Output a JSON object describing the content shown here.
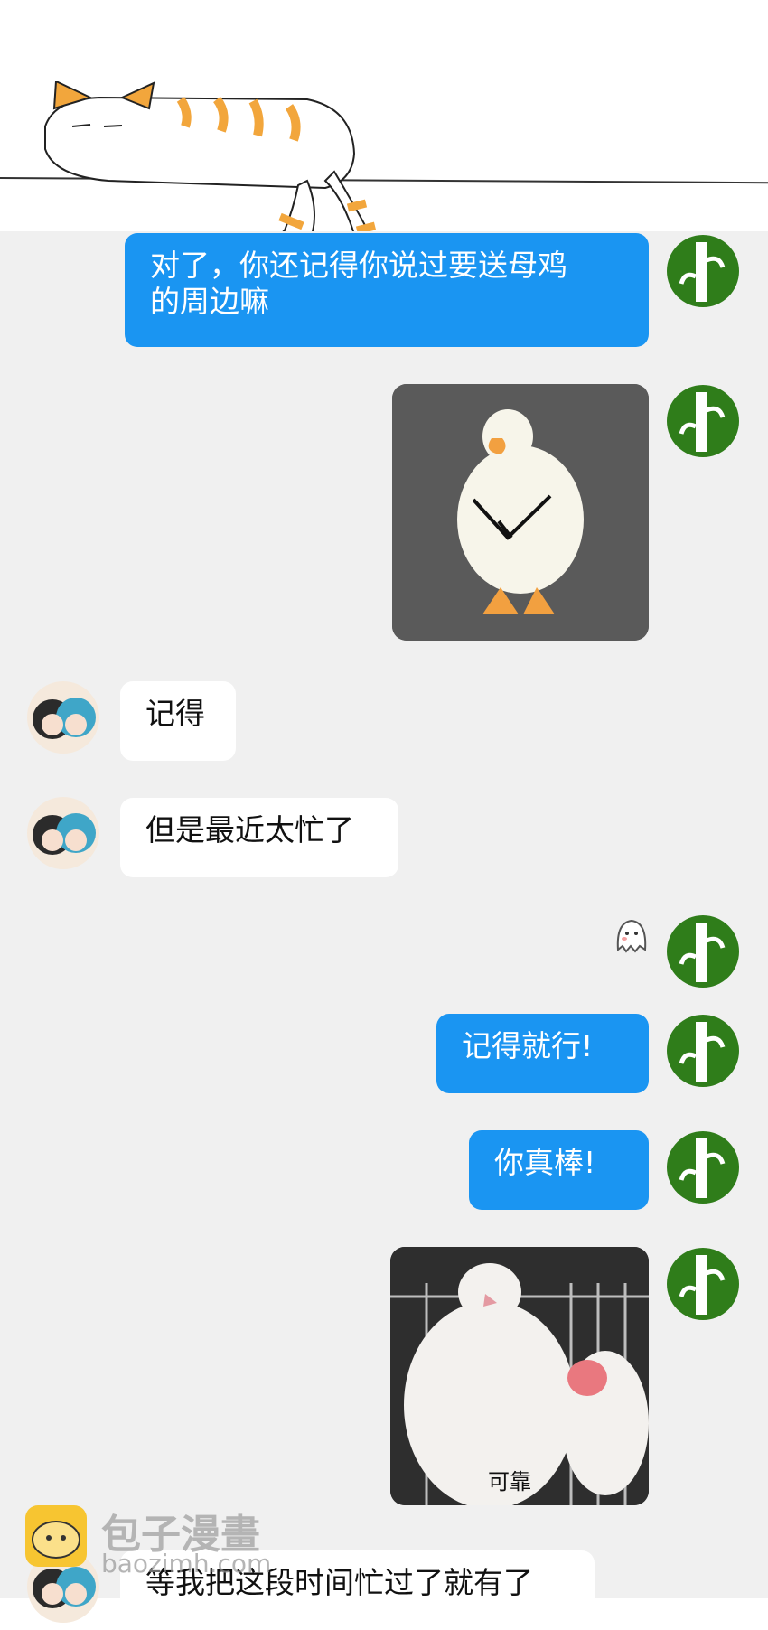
{
  "messages": [
    {
      "side": "me",
      "type": "text",
      "text": "对了，你还记得你说过要送母鸡\n的周边嘛"
    },
    {
      "side": "me",
      "type": "image",
      "image_name": "duck-photo"
    },
    {
      "side": "them",
      "type": "text",
      "text": "记得"
    },
    {
      "side": "them",
      "type": "text",
      "text": "但是最近太忙了"
    },
    {
      "side": "me",
      "type": "sticker",
      "image_name": "ghost-sticker"
    },
    {
      "side": "me",
      "type": "text",
      "text": "记得就行!"
    },
    {
      "side": "me",
      "type": "text",
      "text": "你真棒!"
    },
    {
      "side": "me",
      "type": "image",
      "image_name": "birds-photo",
      "caption": "可靠"
    },
    {
      "side": "them",
      "type": "text",
      "text": "等我把这段时间忙过了就有了"
    }
  ],
  "watermark": {
    "title": "包子漫畫",
    "site": "baozimh.com"
  },
  "colors": {
    "my_bubble": "#1a95f2",
    "their_bubble": "#ffffff",
    "chat_bg": "#f0f0f0",
    "bamboo_avatar": "#2f7d1a"
  }
}
